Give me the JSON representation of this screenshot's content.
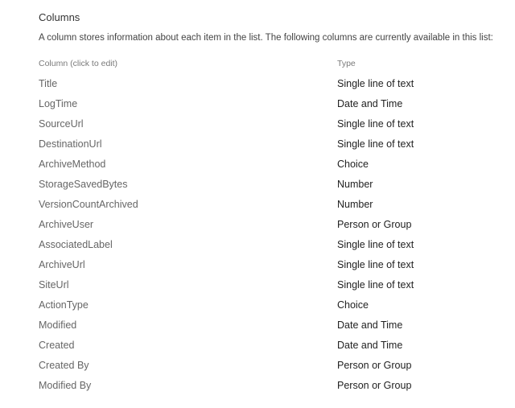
{
  "section": {
    "title": "Columns",
    "description": "A column stores information about each item in the list. The following columns are currently available in this list:"
  },
  "table": {
    "headers": {
      "name": "Column (click to edit)",
      "type": "Type"
    },
    "rows": [
      {
        "name": "Title",
        "type": "Single line of text"
      },
      {
        "name": "LogTime",
        "type": "Date and Time"
      },
      {
        "name": "SourceUrl",
        "type": "Single line of text"
      },
      {
        "name": "DestinationUrl",
        "type": "Single line of text"
      },
      {
        "name": "ArchiveMethod",
        "type": "Choice"
      },
      {
        "name": "StorageSavedBytes",
        "type": "Number"
      },
      {
        "name": "VersionCountArchived",
        "type": "Number"
      },
      {
        "name": "ArchiveUser",
        "type": "Person or Group"
      },
      {
        "name": "AssociatedLabel",
        "type": "Single line of text"
      },
      {
        "name": "ArchiveUrl",
        "type": "Single line of text"
      },
      {
        "name": "SiteUrl",
        "type": "Single line of text"
      },
      {
        "name": "ActionType",
        "type": "Choice"
      },
      {
        "name": "Modified",
        "type": "Date and Time"
      },
      {
        "name": "Created",
        "type": "Date and Time"
      },
      {
        "name": "Created By",
        "type": "Person or Group"
      },
      {
        "name": "Modified By",
        "type": "Person or Group"
      }
    ]
  }
}
